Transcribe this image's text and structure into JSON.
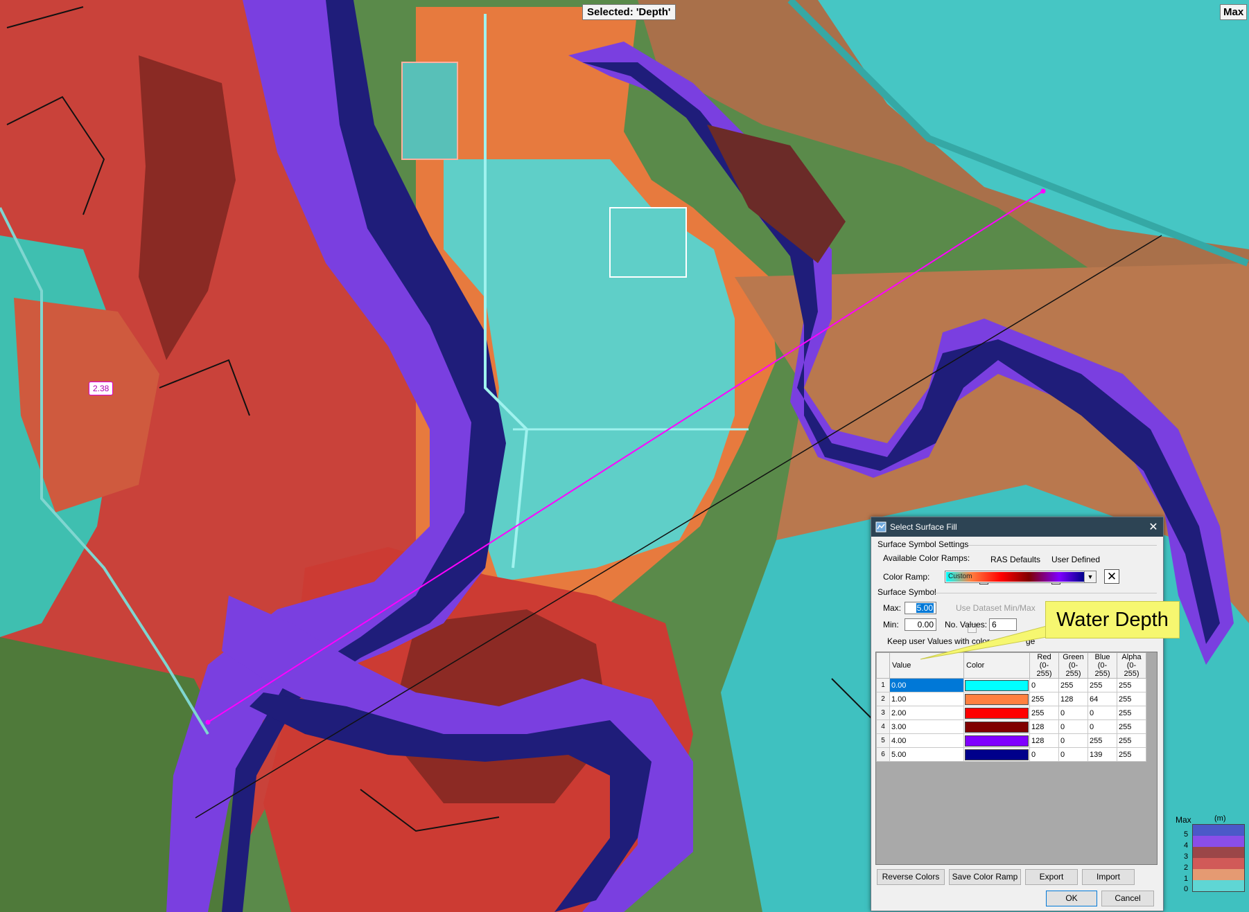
{
  "map": {
    "selected_label": "Selected: 'Depth'",
    "max_label": "Max",
    "profile_value": "2.38"
  },
  "legend": {
    "title": "Max",
    "unit": "(m)",
    "ticks": [
      "5",
      "4",
      "3",
      "2",
      "1",
      "0"
    ],
    "band_colors": [
      "#4b59c8",
      "#8a4ee8",
      "#9b4648",
      "#d15a58",
      "#e59a72",
      "#5fd6d4"
    ]
  },
  "callout": {
    "text": "Water Depth"
  },
  "dialog": {
    "title": "Select Surface Fill",
    "close_glyph": "✕",
    "symbol_settings_group": "Surface Symbol Settings",
    "available_ramps_label": "Available Color Ramps:",
    "ras_defaults_label": "RAS Defaults",
    "ras_defaults_checked": true,
    "user_defined_label": "User Defined",
    "user_defined_checked": true,
    "color_ramp_label": "Color Ramp:",
    "color_ramp_value": "Custom",
    "clear_glyph": "✕",
    "surface_symbol_group": "Surface Symbol",
    "max_label": "Max:",
    "max_value": "5.00",
    "min_label": "Min:",
    "min_value": "0.00",
    "use_dataset_label": "Use Dataset Min/Max",
    "no_values_label": "No. Values:",
    "no_values_value": "6",
    "keep_user_values_label": "Keep user Values with color",
    "keep_user_values_suffix": "ge",
    "table": {
      "headers": {
        "value": "Value",
        "color": "Color",
        "red": [
          "Red",
          "(0-255)"
        ],
        "green": [
          "Green",
          "(0-255)"
        ],
        "blue": [
          "Blue",
          "(0-255)"
        ],
        "alpha": [
          "Alpha",
          "(0-255)"
        ]
      },
      "rows": [
        {
          "n": "1",
          "value": "0.00",
          "color": "#00ffff",
          "r": "0",
          "g": "255",
          "b": "255",
          "a": "255"
        },
        {
          "n": "2",
          "value": "1.00",
          "color": "#ff8040",
          "r": "255",
          "g": "128",
          "b": "64",
          "a": "255"
        },
        {
          "n": "3",
          "value": "2.00",
          "color": "#ff0000",
          "r": "255",
          "g": "0",
          "b": "0",
          "a": "255"
        },
        {
          "n": "4",
          "value": "3.00",
          "color": "#800000",
          "r": "128",
          "g": "0",
          "b": "0",
          "a": "255"
        },
        {
          "n": "5",
          "value": "4.00",
          "color": "#8000ff",
          "r": "128",
          "g": "0",
          "b": "255",
          "a": "255"
        },
        {
          "n": "6",
          "value": "5.00",
          "color": "#00008b",
          "r": "0",
          "g": "0",
          "b": "139",
          "a": "255"
        }
      ]
    },
    "buttons": {
      "reverse": "Reverse Colors",
      "save_ramp": "Save Color Ramp",
      "export": "Export",
      "import": "Import",
      "ok": "OK",
      "cancel": "Cancel"
    }
  }
}
